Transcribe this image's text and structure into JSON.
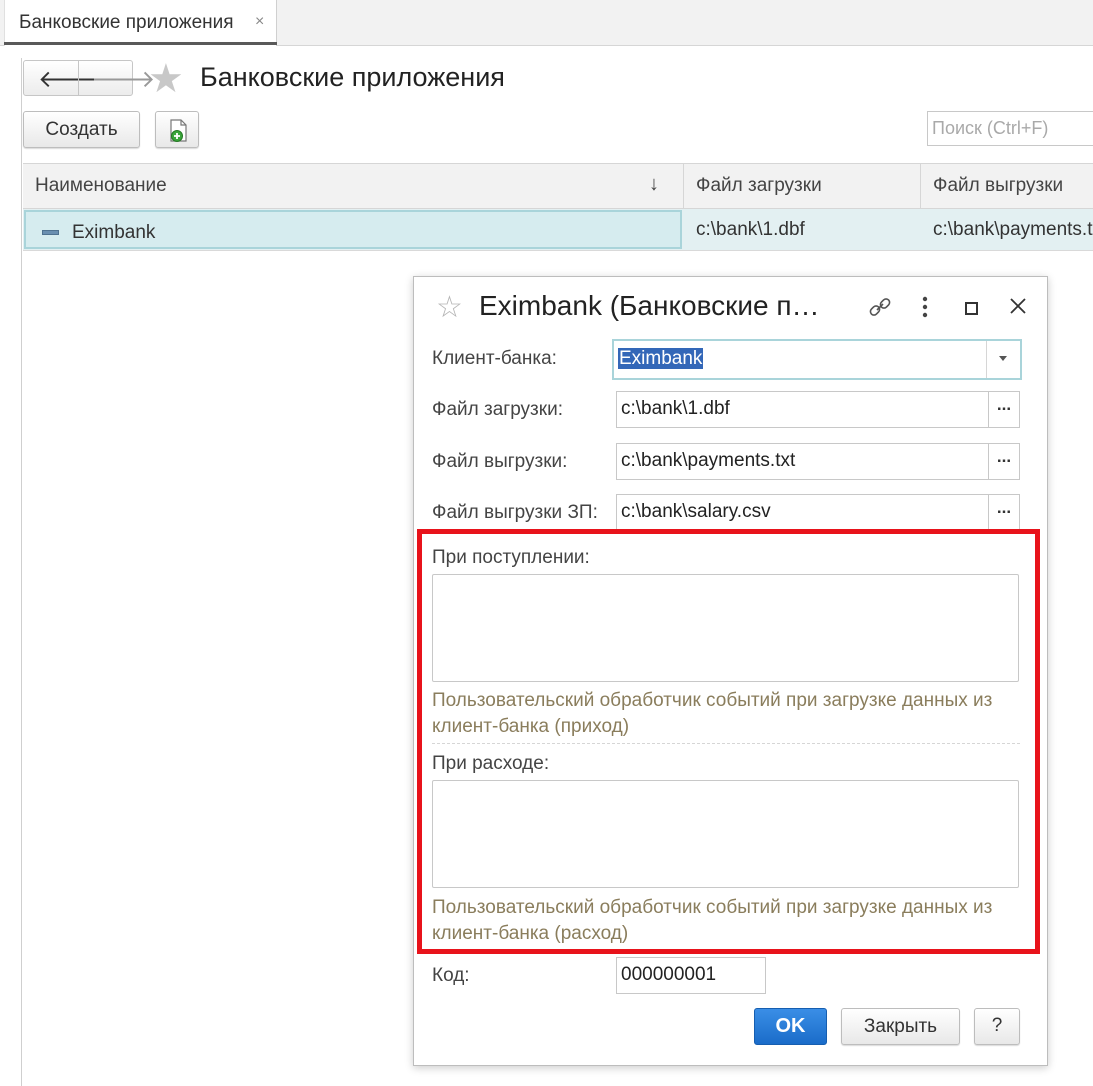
{
  "tabbar": {
    "tab_label": "Банковские приложения",
    "tab_close": "×"
  },
  "nav": {
    "back": "🡐",
    "forward": "🡒"
  },
  "page": {
    "title": "Банковские приложения"
  },
  "toolbar": {
    "create_label": "Создать"
  },
  "search": {
    "placeholder": "Поиск (Ctrl+F)"
  },
  "table": {
    "columns": [
      "Наименование",
      "Файл загрузки",
      "Файл выгрузки"
    ],
    "sort_indicator": "↓",
    "rows": [
      {
        "name": "Eximbank",
        "load_file": "c:\\bank\\1.dbf",
        "unload_file": "c:\\bank\\payments.txt"
      }
    ]
  },
  "dialog": {
    "title": "Eximbank (Банковские п…",
    "fields": {
      "client_bank_label": "Клиент-банка:",
      "client_bank_value": "Eximbank",
      "load_label": "Файл загрузки:",
      "load_value": "c:\\bank\\1.dbf",
      "unload_label": "Файл выгрузки:",
      "unload_value": "c:\\bank\\payments.txt",
      "salary_label": "Файл выгрузки ЗП:",
      "salary_value": "c:\\bank\\salary.csv",
      "dots": "..."
    },
    "income": {
      "label": "При поступлении:",
      "hint": "Пользовательский обработчик событий при загрузке данных из клиент-банка (приход)"
    },
    "expense": {
      "label": "При расходе:",
      "hint": "Пользовательский обработчик событий при загрузке данных из клиент-банка (расход)"
    },
    "code": {
      "label": "Код:",
      "value": "000000001"
    },
    "buttons": {
      "ok": "OK",
      "close": "Закрыть",
      "help": "?"
    }
  },
  "colors": {
    "highlight_border": "#e8131b",
    "ok_button": "#1a6cc9",
    "selection": "#3367b8",
    "row_selected": "#e3f0f2"
  }
}
